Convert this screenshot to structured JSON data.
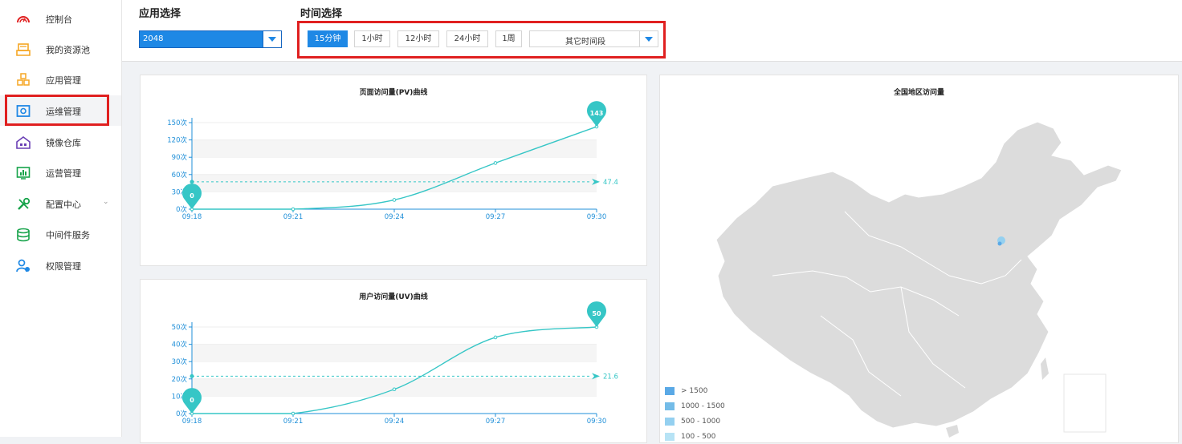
{
  "sidebar": {
    "items": [
      {
        "label": "控制台",
        "icon": "dashboard-gauge-icon",
        "color": "#e02020"
      },
      {
        "label": "我的资源池",
        "icon": "resource-pool-icon",
        "color": "#f5a623"
      },
      {
        "label": "应用管理",
        "icon": "app-cubes-icon",
        "color": "#f5a623"
      },
      {
        "label": "运维管理",
        "icon": "ops-monitor-icon",
        "color": "#1e88e5"
      },
      {
        "label": "镜像仓库",
        "icon": "warehouse-icon",
        "color": "#6a3fb5"
      },
      {
        "label": "运营管理",
        "icon": "operation-chart-icon",
        "color": "#16a34a"
      },
      {
        "label": "配置中心",
        "icon": "config-tools-icon",
        "color": "#16a34a",
        "chevron": "⌄"
      },
      {
        "label": "中间件服务",
        "icon": "middleware-database-icon",
        "color": "#16a34a"
      },
      {
        "label": "权限管理",
        "icon": "permission-user-icon",
        "color": "#1e88e5"
      }
    ]
  },
  "header": {
    "app_select_title": "应用选择",
    "app_select_value": "2048",
    "time_select_title": "时间选择",
    "time_buttons": [
      "15分钟",
      "1小时",
      "12小时",
      "24小时",
      "1周"
    ],
    "time_selected": "15分钟",
    "time_other": "其它时间段"
  },
  "colors": {
    "accent": "#1e88e5",
    "line": "#36c6c6",
    "axis": "#1f8fd8",
    "highlight": "#e02020"
  },
  "pv_chart": {
    "title": "页面访问量(PV)曲线"
  },
  "uv_chart": {
    "title": "用户访问量(UV)曲线"
  },
  "map": {
    "title": "全国地区访问量",
    "legend": [
      {
        "label": "> 1500",
        "color": "#5aa9e6"
      },
      {
        "label": "1000 - 1500",
        "color": "#74bce8"
      },
      {
        "label": "500 - 1000",
        "color": "#94d0f0"
      },
      {
        "label": "100 - 500",
        "color": "#b7e3f5"
      }
    ]
  },
  "chart_data": [
    {
      "type": "line",
      "title": "页面访问量(PV)曲线",
      "x": [
        "09:18",
        "09:21",
        "09:24",
        "09:27",
        "09:30"
      ],
      "y_ticks": [
        "0次",
        "30次",
        "60次",
        "90次",
        "120次",
        "150次"
      ],
      "ylim": [
        0,
        150
      ],
      "series": [
        {
          "values": [
            0,
            0,
            16,
            80,
            143
          ]
        }
      ],
      "markpoints": {
        "min": 0,
        "max": 143
      },
      "markline_average": 47.4
    },
    {
      "type": "line",
      "title": "用户访问量(UV)曲线",
      "x": [
        "09:18",
        "09:21",
        "09:24",
        "09:27",
        "09:30"
      ],
      "y_ticks": [
        "0次",
        "10次",
        "20次",
        "30次",
        "40次",
        "50次"
      ],
      "ylim": [
        0,
        50
      ],
      "series": [
        {
          "values": [
            0,
            0,
            14,
            44,
            50
          ]
        }
      ],
      "markpoints": {
        "min": 0,
        "max": 50
      },
      "markline_average": 21.6
    }
  ]
}
